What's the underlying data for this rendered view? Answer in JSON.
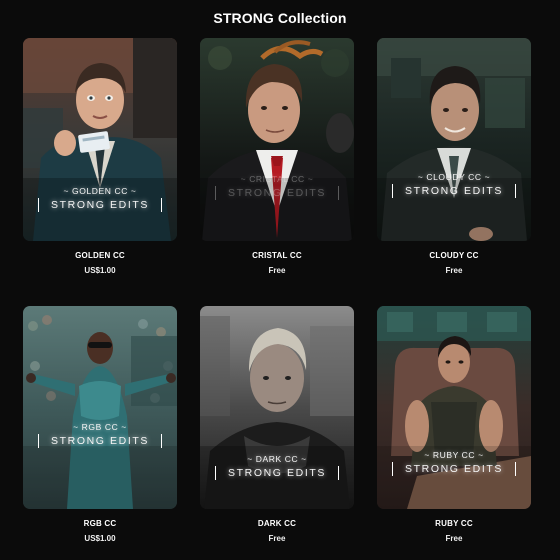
{
  "collection": {
    "title": "STRONG Collection"
  },
  "products": [
    {
      "overlay_top": "~ GOLDEN CC ~",
      "overlay_main": "STRONG EDITS",
      "name": "GOLDEN CC",
      "price": "US$1.00"
    },
    {
      "overlay_top": "~ CRISTAL CC ~",
      "overlay_main": "STRONG EDITS",
      "name": "CRISTAL CC",
      "price": "Free"
    },
    {
      "overlay_top": "~ CLOUDY CC ~",
      "overlay_main": "STRONG EDITS",
      "name": "CLOUDY CC",
      "price": "Free"
    },
    {
      "overlay_top": "~ RGB CC ~",
      "overlay_main": "STRONG EDITS",
      "name": "RGB CC",
      "price": "US$1.00"
    },
    {
      "overlay_top": "~ DARK CC ~",
      "overlay_main": "STRONG EDITS",
      "name": "DARK CC",
      "price": "Free"
    },
    {
      "overlay_top": "~ RUBY CC ~",
      "overlay_main": "STRONG EDITS",
      "name": "RUBY CC",
      "price": "Free"
    }
  ],
  "colors": {
    "page_background": "#0b0b0b",
    "text": "#ffffff"
  }
}
